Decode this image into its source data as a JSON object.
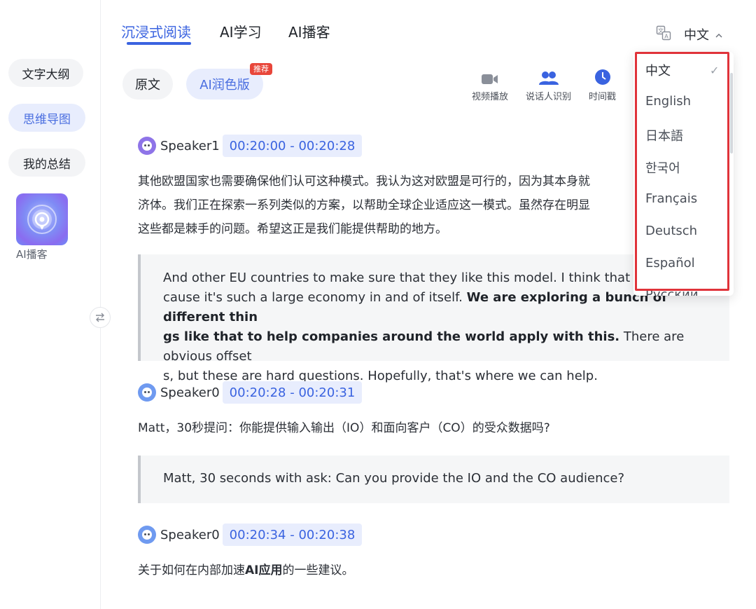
{
  "sidebar": {
    "items": [
      {
        "label": "文字大纲"
      },
      {
        "label": "思维导图"
      },
      {
        "label": "我的总结"
      }
    ],
    "podcast_label": "AI播客"
  },
  "tabs": [
    {
      "label": "沉浸式阅读"
    },
    {
      "label": "AI学习"
    },
    {
      "label": "AI播客"
    }
  ],
  "language": {
    "current": "中文",
    "options": [
      "中文",
      "English",
      "日本語",
      "한국어",
      "Français",
      "Deutsch",
      "Español",
      "Русский"
    ],
    "check_mark": "✓"
  },
  "versions": {
    "original": "原文",
    "ai": "AI润色版",
    "badge": "推荐"
  },
  "toolbar": [
    {
      "label": "视频播放",
      "icon": "video-icon"
    },
    {
      "label": "说话人识别",
      "icon": "speakers-icon"
    },
    {
      "label": "时间戳",
      "icon": "clock-icon"
    }
  ],
  "transcript": [
    {
      "speaker": "Speaker1",
      "time": "00:20:00 - 00:20:28",
      "zh_lines": [
        "其他欧盟国家也需要确保他们认可这种模式。我认为这对欧盟是可行的，因为其本身就",
        "济体。我们正在探索一系列类似的方案，以帮助全球企业适应这一模式。虽然存在明显",
        "这些都是棘手的问题。希望这正是我们能提供帮助的地方。"
      ],
      "en": {
        "line1": "And other EU countries to make sure that they like this model. I think that works f",
        "line2_plain": "cause it's such a large economy in and of itself. ",
        "line2_bold": "We are exploring a bunch of different thin",
        "line3_bold": "gs like that to help companies around the world apply with this.",
        "line3_plain": " There are obvious offset",
        "line4": "s, but these are hard questions. Hopefully, that's where we can help."
      }
    },
    {
      "speaker": "Speaker0",
      "time": "00:20:28 - 00:20:31",
      "zh": "Matt，30秒提问：你能提供输入输出（IO）和面向客户（CO）的受众数据吗?",
      "en": "Matt, 30 seconds with ask: Can you provide the IO and the CO audience?"
    },
    {
      "speaker": "Speaker0",
      "time": "00:20:34 - 00:20:38",
      "zh_pre": "关于如何在内部加速",
      "zh_bold": "AI应用",
      "zh_post": "的一些建议。"
    }
  ],
  "colors": {
    "accent": "#3a63e0",
    "highlight_border": "#e0333a",
    "badge": "#e8463a"
  }
}
